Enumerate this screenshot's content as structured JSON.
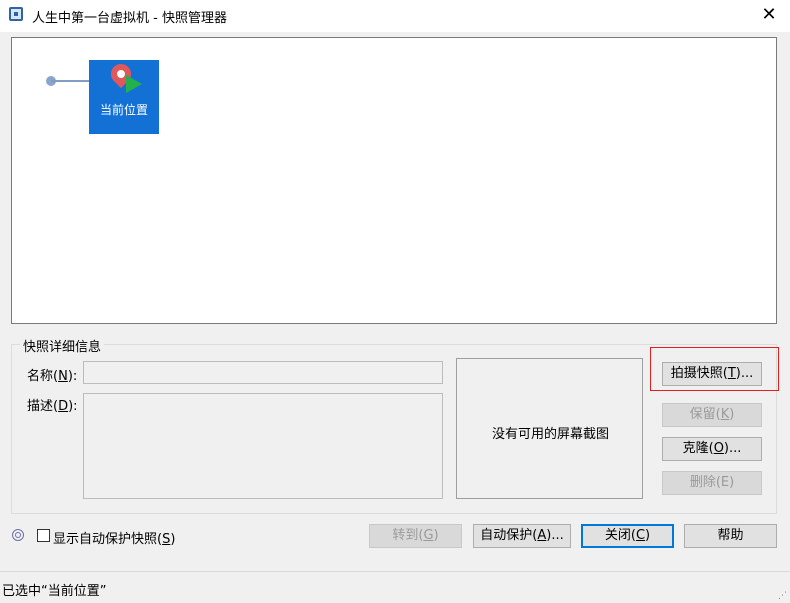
{
  "window": {
    "title": "人生中第一台虚拟机 - 快照管理器",
    "close": "✕"
  },
  "tree": {
    "node_label": "当前位置"
  },
  "details": {
    "group_title": "快照详细信息",
    "name": {
      "label": "名称(",
      "key": "N",
      "suffix": "):",
      "value": ""
    },
    "desc": {
      "label": "描述(",
      "key": "D",
      "suffix": "):",
      "value": ""
    },
    "screenshot_text": "没有可用的屏幕截图"
  },
  "buttons": {
    "take": {
      "label": "拍摄快照(",
      "key": "T",
      "suffix": ")..."
    },
    "keep": {
      "label": "保留(",
      "key": "K",
      "suffix": ")"
    },
    "clone": {
      "label": "克隆(",
      "key": "O",
      "suffix": ")..."
    },
    "delete": {
      "label": "删除(E)"
    },
    "goto": {
      "label": "转到(",
      "key": "G",
      "suffix": ")"
    },
    "autoprotect": {
      "label": "自动保护(",
      "key": "A",
      "suffix": ")..."
    },
    "close": {
      "label": "关闭(",
      "key": "C",
      "suffix": ")"
    },
    "help": {
      "label": "帮助"
    }
  },
  "autoprotect_toggle": {
    "label": "显示自动保护快照(",
    "key": "S",
    "suffix": ")",
    "checked": false
  },
  "status": {
    "text": "已选中“当前位置”"
  },
  "colors": {
    "node_bg": "#1371d6",
    "highlight": "#e02020",
    "default_btn_border": "#0078d7"
  }
}
